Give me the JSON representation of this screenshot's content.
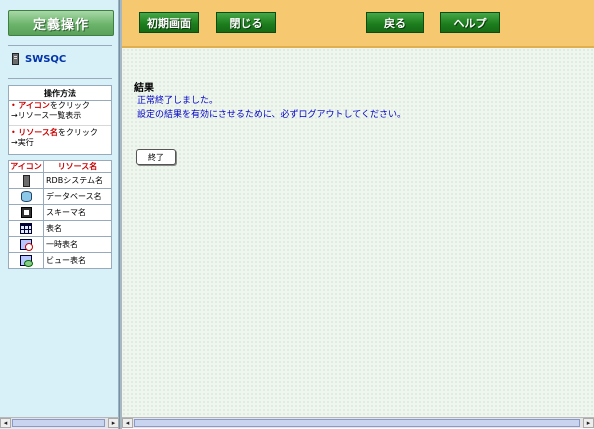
{
  "sidebar": {
    "title": "定義操作",
    "server_name": "SWSQC",
    "howto": {
      "heading": "操作方法",
      "item1_hl": "アイコン",
      "item1_rest": "をクリック",
      "item1_sub": "→リソース一覧表示",
      "item2_hl": "リソース名",
      "item2_rest": "をクリック",
      "item2_sub": "→実行"
    },
    "legend": {
      "col_icon": "アイコン",
      "col_name": "リソース名",
      "rows": [
        {
          "icon": "rdb-system-icon",
          "label": "RDBシステム名"
        },
        {
          "icon": "database-icon",
          "label": "データベース名"
        },
        {
          "icon": "schema-icon",
          "label": "スキーマ名"
        },
        {
          "icon": "table-icon",
          "label": "表名"
        },
        {
          "icon": "temp-table-icon",
          "label": "一時表名"
        },
        {
          "icon": "view-table-icon",
          "label": "ビュー表名"
        }
      ]
    }
  },
  "toolbar": {
    "home_label": "初期画面",
    "close_label": "閉じる",
    "back_label": "戻る",
    "help_label": "ヘルプ"
  },
  "main": {
    "result_heading": "結果",
    "message_line1": "正常終了しました。",
    "message_line2": "設定の結果を有効にさせるために、必ずログアウトしてください。",
    "end_button": "終了"
  },
  "colors": {
    "toolbar_bg": "#f6c870",
    "sidebar_bg": "#d8f0f8",
    "button_green": "#1c7c1c",
    "message_blue": "#0000c8",
    "highlight_red": "#cc0000"
  }
}
